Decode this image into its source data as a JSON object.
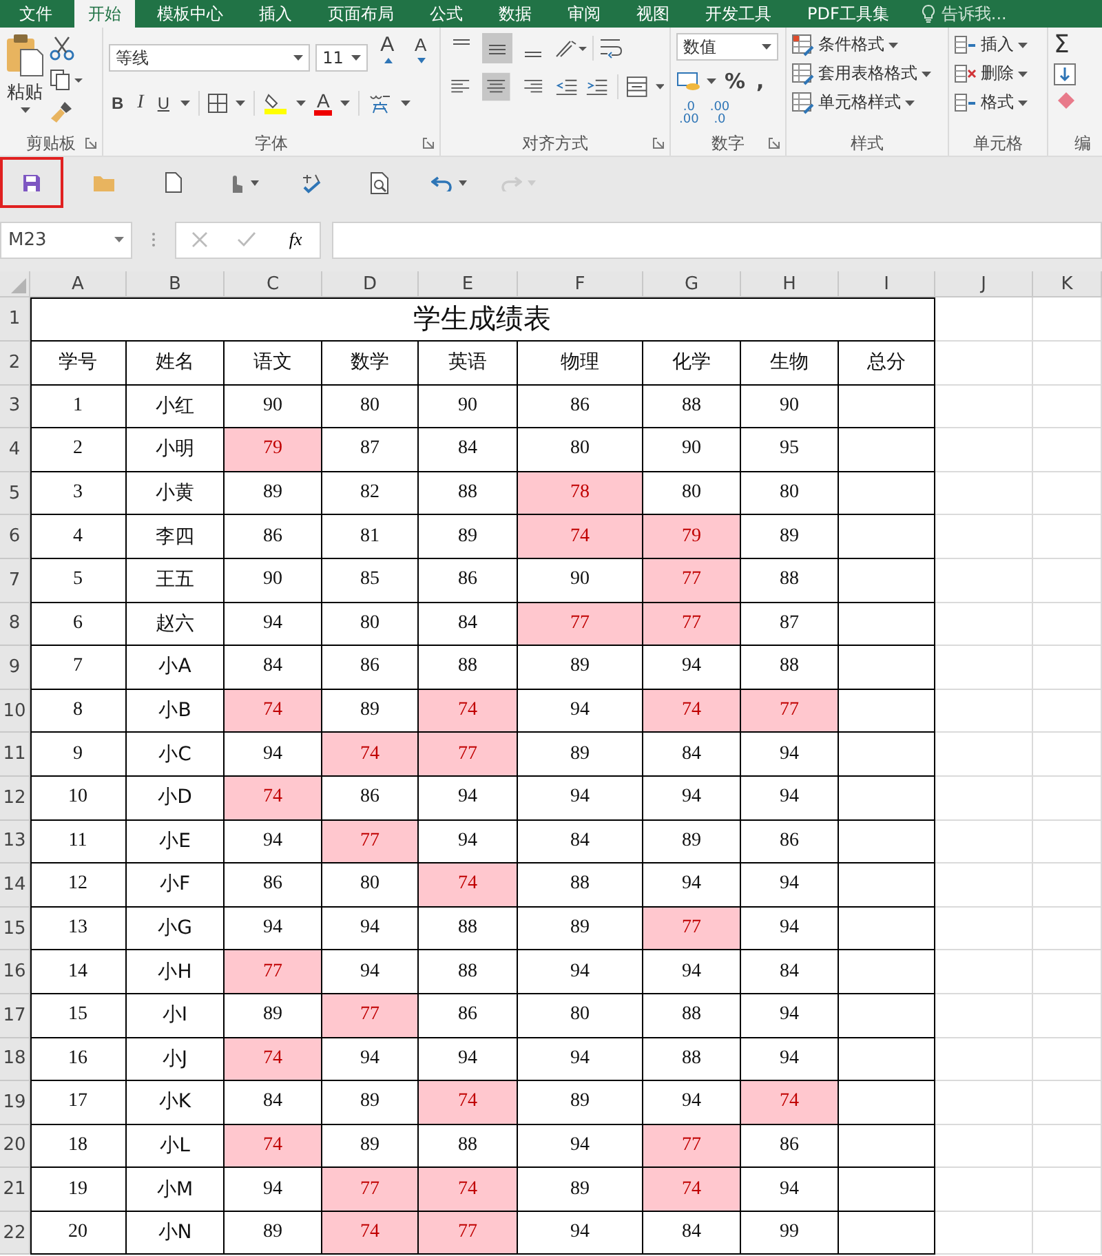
{
  "menu_tabs": [
    {
      "label": "文件",
      "selected": false
    },
    {
      "label": "开始",
      "selected": true
    },
    {
      "label": "模板中心",
      "selected": false
    },
    {
      "label": "插入",
      "selected": false
    },
    {
      "label": "页面布局",
      "selected": false
    },
    {
      "label": "公式",
      "selected": false
    },
    {
      "label": "数据",
      "selected": false
    },
    {
      "label": "审阅",
      "selected": false
    },
    {
      "label": "视图",
      "selected": false
    },
    {
      "label": "开发工具",
      "selected": false
    },
    {
      "label": "PDF工具集",
      "selected": false
    }
  ],
  "tell_me": "告诉我...",
  "ribbon": {
    "clipboard": {
      "paste": "粘贴",
      "label": "剪贴板"
    },
    "font": {
      "name": "等线",
      "size": "11",
      "grow": "A",
      "shrink": "A",
      "bold": "B",
      "italic": "I",
      "underline": "U",
      "font_color": "A",
      "label": "字体"
    },
    "alignment": {
      "vertical": [
        {
          "selected": false
        },
        {
          "selected": true
        },
        {
          "selected": false
        }
      ],
      "horizontal": [
        {
          "selected": false
        },
        {
          "selected": true
        },
        {
          "selected": false
        }
      ],
      "label": "对齐方式"
    },
    "number": {
      "format": "数值",
      "percent": "%",
      "comma": ",",
      "increase_decimal": [
        ".0",
        ".00"
      ],
      "decrease_decimal": [
        ".00",
        ".0"
      ],
      "label": "数字"
    },
    "styles": {
      "items": [
        "条件格式",
        "套用表格格式",
        "单元格样式"
      ],
      "label": "样式"
    },
    "cells": {
      "items": [
        "插入",
        "删除",
        "格式"
      ],
      "label": "单元格"
    },
    "editing": {
      "sum": "Σ",
      "label": "编"
    }
  },
  "quick_access": [
    {
      "kind": "save",
      "outlined": true,
      "disabled": false
    },
    {
      "kind": "open",
      "outlined": false,
      "disabled": false
    },
    {
      "kind": "new",
      "outlined": false,
      "disabled": false
    },
    {
      "kind": "touch",
      "outlined": false,
      "disabled": false
    },
    {
      "kind": "spelling",
      "outlined": false,
      "disabled": false
    },
    {
      "kind": "preview",
      "outlined": false,
      "disabled": false
    },
    {
      "kind": "undo",
      "outlined": false,
      "disabled": false
    },
    {
      "kind": "redo",
      "outlined": false,
      "disabled": true
    }
  ],
  "name_box": "M23",
  "fx": "fx",
  "sheet": {
    "columns": [
      "A",
      "B",
      "C",
      "D",
      "E",
      "F",
      "G",
      "H",
      "I",
      "J",
      "K"
    ],
    "row_numbers": [
      "1",
      "2",
      "3",
      "4",
      "5",
      "6",
      "7",
      "8",
      "9",
      "10",
      "11",
      "12",
      "13",
      "14",
      "15",
      "16",
      "17",
      "18",
      "19",
      "20",
      "21",
      "22"
    ],
    "title": "学生成绩表",
    "headers": [
      "学号",
      "姓名",
      "语文",
      "数学",
      "英语",
      "物理",
      "化学",
      "生物",
      "总分"
    ],
    "rows": [
      {
        "id": "1",
        "name": "小红",
        "scores": [
          {
            "value": "90",
            "low": false
          },
          {
            "value": "80",
            "low": false
          },
          {
            "value": "90",
            "low": false
          },
          {
            "value": "86",
            "low": false
          },
          {
            "value": "88",
            "low": false
          },
          {
            "value": "90",
            "low": false
          }
        ]
      },
      {
        "id": "2",
        "name": "小明",
        "scores": [
          {
            "value": "79",
            "low": true
          },
          {
            "value": "87",
            "low": false
          },
          {
            "value": "84",
            "low": false
          },
          {
            "value": "80",
            "low": false
          },
          {
            "value": "90",
            "low": false
          },
          {
            "value": "95",
            "low": false
          }
        ]
      },
      {
        "id": "3",
        "name": "小黄",
        "scores": [
          {
            "value": "89",
            "low": false
          },
          {
            "value": "82",
            "low": false
          },
          {
            "value": "88",
            "low": false
          },
          {
            "value": "78",
            "low": true
          },
          {
            "value": "80",
            "low": false
          },
          {
            "value": "80",
            "low": false
          }
        ]
      },
      {
        "id": "4",
        "name": "李四",
        "scores": [
          {
            "value": "86",
            "low": false
          },
          {
            "value": "81",
            "low": false
          },
          {
            "value": "89",
            "low": false
          },
          {
            "value": "74",
            "low": true
          },
          {
            "value": "79",
            "low": true
          },
          {
            "value": "89",
            "low": false
          }
        ]
      },
      {
        "id": "5",
        "name": "王五",
        "scores": [
          {
            "value": "90",
            "low": false
          },
          {
            "value": "85",
            "low": false
          },
          {
            "value": "86",
            "low": false
          },
          {
            "value": "90",
            "low": false
          },
          {
            "value": "77",
            "low": true
          },
          {
            "value": "88",
            "low": false
          }
        ]
      },
      {
        "id": "6",
        "name": "赵六",
        "scores": [
          {
            "value": "94",
            "low": false
          },
          {
            "value": "80",
            "low": false
          },
          {
            "value": "84",
            "low": false
          },
          {
            "value": "77",
            "low": true
          },
          {
            "value": "77",
            "low": true
          },
          {
            "value": "87",
            "low": false
          }
        ]
      },
      {
        "id": "7",
        "name": "小A",
        "scores": [
          {
            "value": "84",
            "low": false
          },
          {
            "value": "86",
            "low": false
          },
          {
            "value": "88",
            "low": false
          },
          {
            "value": "89",
            "low": false
          },
          {
            "value": "94",
            "low": false
          },
          {
            "value": "88",
            "low": false
          }
        ]
      },
      {
        "id": "8",
        "name": "小B",
        "scores": [
          {
            "value": "74",
            "low": true
          },
          {
            "value": "89",
            "low": false
          },
          {
            "value": "74",
            "low": true
          },
          {
            "value": "94",
            "low": false
          },
          {
            "value": "74",
            "low": true
          },
          {
            "value": "77",
            "low": true
          }
        ]
      },
      {
        "id": "9",
        "name": "小C",
        "scores": [
          {
            "value": "94",
            "low": false
          },
          {
            "value": "74",
            "low": true
          },
          {
            "value": "77",
            "low": true
          },
          {
            "value": "89",
            "low": false
          },
          {
            "value": "84",
            "low": false
          },
          {
            "value": "94",
            "low": false
          }
        ]
      },
      {
        "id": "10",
        "name": "小D",
        "scores": [
          {
            "value": "74",
            "low": true
          },
          {
            "value": "86",
            "low": false
          },
          {
            "value": "94",
            "low": false
          },
          {
            "value": "94",
            "low": false
          },
          {
            "value": "94",
            "low": false
          },
          {
            "value": "94",
            "low": false
          }
        ]
      },
      {
        "id": "11",
        "name": "小E",
        "scores": [
          {
            "value": "94",
            "low": false
          },
          {
            "value": "77",
            "low": true
          },
          {
            "value": "94",
            "low": false
          },
          {
            "value": "84",
            "low": false
          },
          {
            "value": "89",
            "low": false
          },
          {
            "value": "86",
            "low": false
          }
        ]
      },
      {
        "id": "12",
        "name": "小F",
        "scores": [
          {
            "value": "86",
            "low": false
          },
          {
            "value": "80",
            "low": false
          },
          {
            "value": "74",
            "low": true
          },
          {
            "value": "88",
            "low": false
          },
          {
            "value": "94",
            "low": false
          },
          {
            "value": "94",
            "low": false
          }
        ]
      },
      {
        "id": "13",
        "name": "小G",
        "scores": [
          {
            "value": "94",
            "low": false
          },
          {
            "value": "94",
            "low": false
          },
          {
            "value": "88",
            "low": false
          },
          {
            "value": "89",
            "low": false
          },
          {
            "value": "77",
            "low": true
          },
          {
            "value": "94",
            "low": false
          }
        ]
      },
      {
        "id": "14",
        "name": "小H",
        "scores": [
          {
            "value": "77",
            "low": true
          },
          {
            "value": "94",
            "low": false
          },
          {
            "value": "88",
            "low": false
          },
          {
            "value": "94",
            "low": false
          },
          {
            "value": "94",
            "low": false
          },
          {
            "value": "84",
            "low": false
          }
        ]
      },
      {
        "id": "15",
        "name": "小I",
        "scores": [
          {
            "value": "89",
            "low": false
          },
          {
            "value": "77",
            "low": true
          },
          {
            "value": "86",
            "low": false
          },
          {
            "value": "80",
            "low": false
          },
          {
            "value": "88",
            "low": false
          },
          {
            "value": "94",
            "low": false
          }
        ]
      },
      {
        "id": "16",
        "name": "小J",
        "scores": [
          {
            "value": "74",
            "low": true
          },
          {
            "value": "94",
            "low": false
          },
          {
            "value": "94",
            "low": false
          },
          {
            "value": "94",
            "low": false
          },
          {
            "value": "88",
            "low": false
          },
          {
            "value": "94",
            "low": false
          }
        ]
      },
      {
        "id": "17",
        "name": "小K",
        "scores": [
          {
            "value": "84",
            "low": false
          },
          {
            "value": "89",
            "low": false
          },
          {
            "value": "74",
            "low": true
          },
          {
            "value": "89",
            "low": false
          },
          {
            "value": "94",
            "low": false
          },
          {
            "value": "74",
            "low": true
          }
        ]
      },
      {
        "id": "18",
        "name": "小L",
        "scores": [
          {
            "value": "74",
            "low": true
          },
          {
            "value": "89",
            "low": false
          },
          {
            "value": "88",
            "low": false
          },
          {
            "value": "94",
            "low": false
          },
          {
            "value": "77",
            "low": true
          },
          {
            "value": "86",
            "low": false
          }
        ]
      },
      {
        "id": "19",
        "name": "小M",
        "scores": [
          {
            "value": "94",
            "low": false
          },
          {
            "value": "77",
            "low": true
          },
          {
            "value": "74",
            "low": true
          },
          {
            "value": "89",
            "low": false
          },
          {
            "value": "74",
            "low": true
          },
          {
            "value": "94",
            "low": false
          }
        ]
      },
      {
        "id": "20",
        "name": "小N",
        "scores": [
          {
            "value": "89",
            "low": false
          },
          {
            "value": "74",
            "low": true
          },
          {
            "value": "77",
            "low": true
          },
          {
            "value": "94",
            "low": false
          },
          {
            "value": "84",
            "low": false
          },
          {
            "value": "99",
            "low": false
          }
        ]
      }
    ]
  }
}
